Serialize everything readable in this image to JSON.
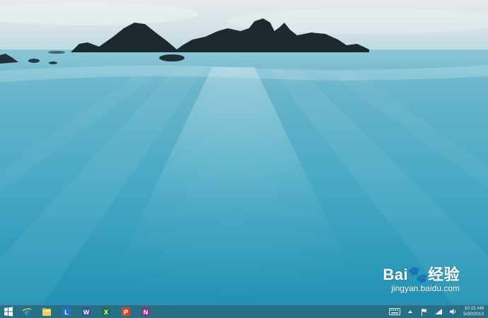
{
  "wallpaper": {
    "subject": "rocky islets above long-exposure surf"
  },
  "watermark": {
    "brand": "Bai🐾经验",
    "url": "jingyan.baidu.com"
  },
  "taskbar": {
    "pinned": [
      {
        "name": "start-button",
        "icon": "windows-logo-icon"
      },
      {
        "name": "internet-explorer",
        "icon": "internet-explorer-icon"
      },
      {
        "name": "file-explorer",
        "icon": "folder-icon"
      },
      {
        "name": "lync",
        "icon": "lync-icon"
      },
      {
        "name": "word",
        "icon": "word-icon"
      },
      {
        "name": "excel",
        "icon": "excel-icon"
      },
      {
        "name": "powerpoint",
        "icon": "powerpoint-icon"
      },
      {
        "name": "onenote",
        "icon": "onenote-icon"
      }
    ],
    "tray": {
      "icons": [
        "keyboard-icon",
        "show-hidden-chevron-icon",
        "flag-icon",
        "network-icon",
        "volume-icon"
      ],
      "time": "10:15 AM",
      "date": "5/30/2013"
    }
  },
  "colors": {
    "taskbar": "#286e82",
    "sea": "#2f9cbb",
    "sky": "#dfe6ea"
  }
}
